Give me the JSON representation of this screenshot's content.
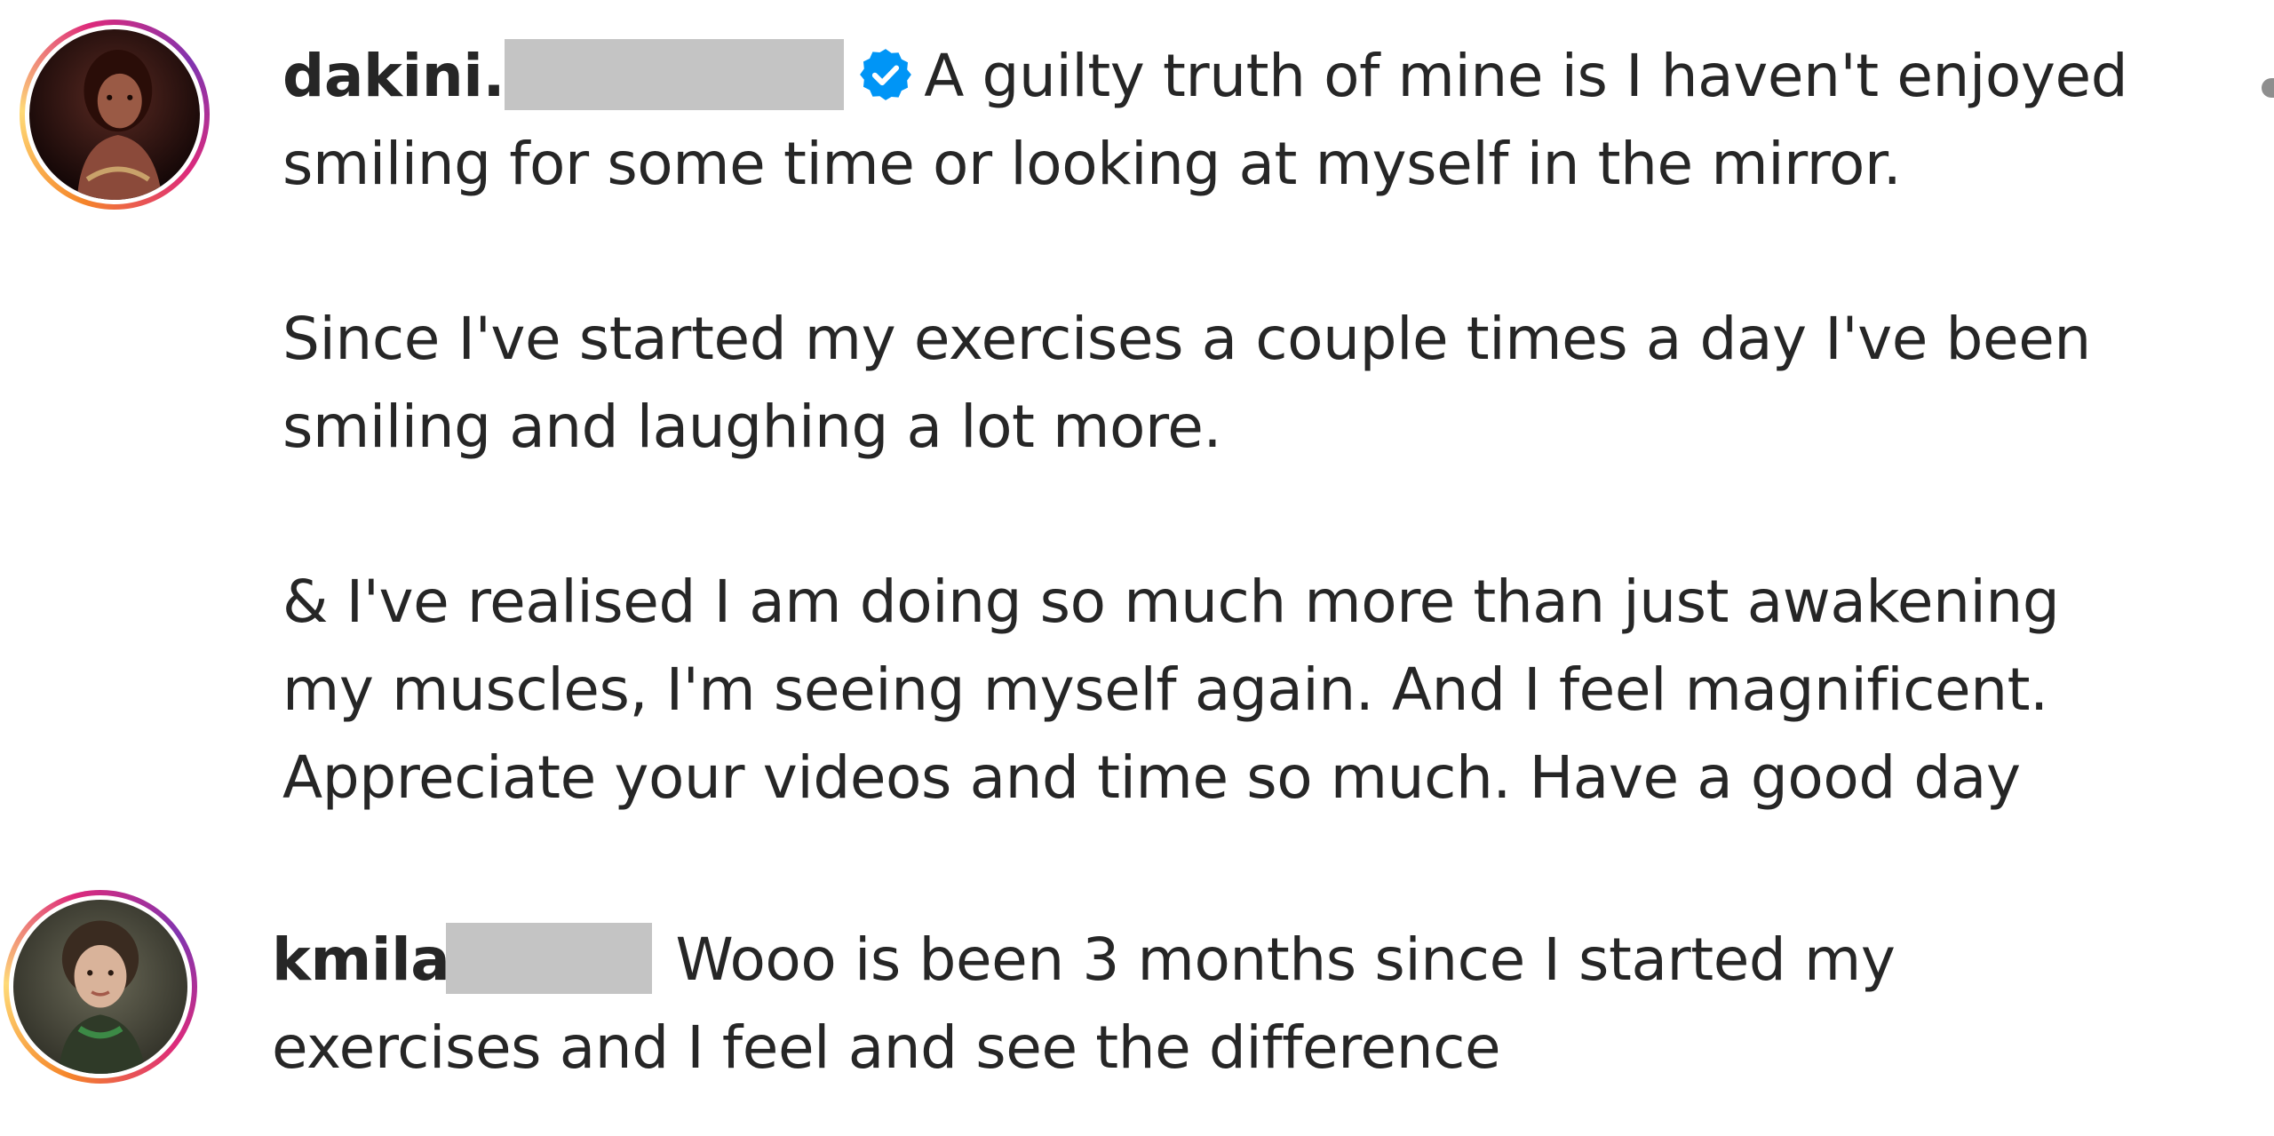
{
  "comments": [
    {
      "username_visible": "dakini.",
      "verified": true,
      "paragraphs": [
        [
          "A guilty truth of mine is I haven't enjoyed",
          "smiling for some time or looking at myself in the mirror."
        ],
        [
          "Since I've started my exercises a couple times a day I've been",
          "smiling and laughing a lot more."
        ],
        [
          "& I've realised I am doing so much more than just awakening",
          "my muscles, I'm seeing myself again. And I feel magnificent.",
          "Appreciate your videos and time so much. Have a good day"
        ]
      ]
    },
    {
      "username_visible": "kmila",
      "verified": false,
      "paragraphs": [
        [
          "Wooo is been 3 months since I started my",
          "exercises and I feel and see the difference"
        ]
      ]
    }
  ],
  "colors": {
    "text": "#262626",
    "verified_badge": "#0095f6",
    "redaction": "#c4c4c4"
  },
  "icons": {
    "verified": "verified-badge-icon",
    "more": "more-options-icon"
  }
}
